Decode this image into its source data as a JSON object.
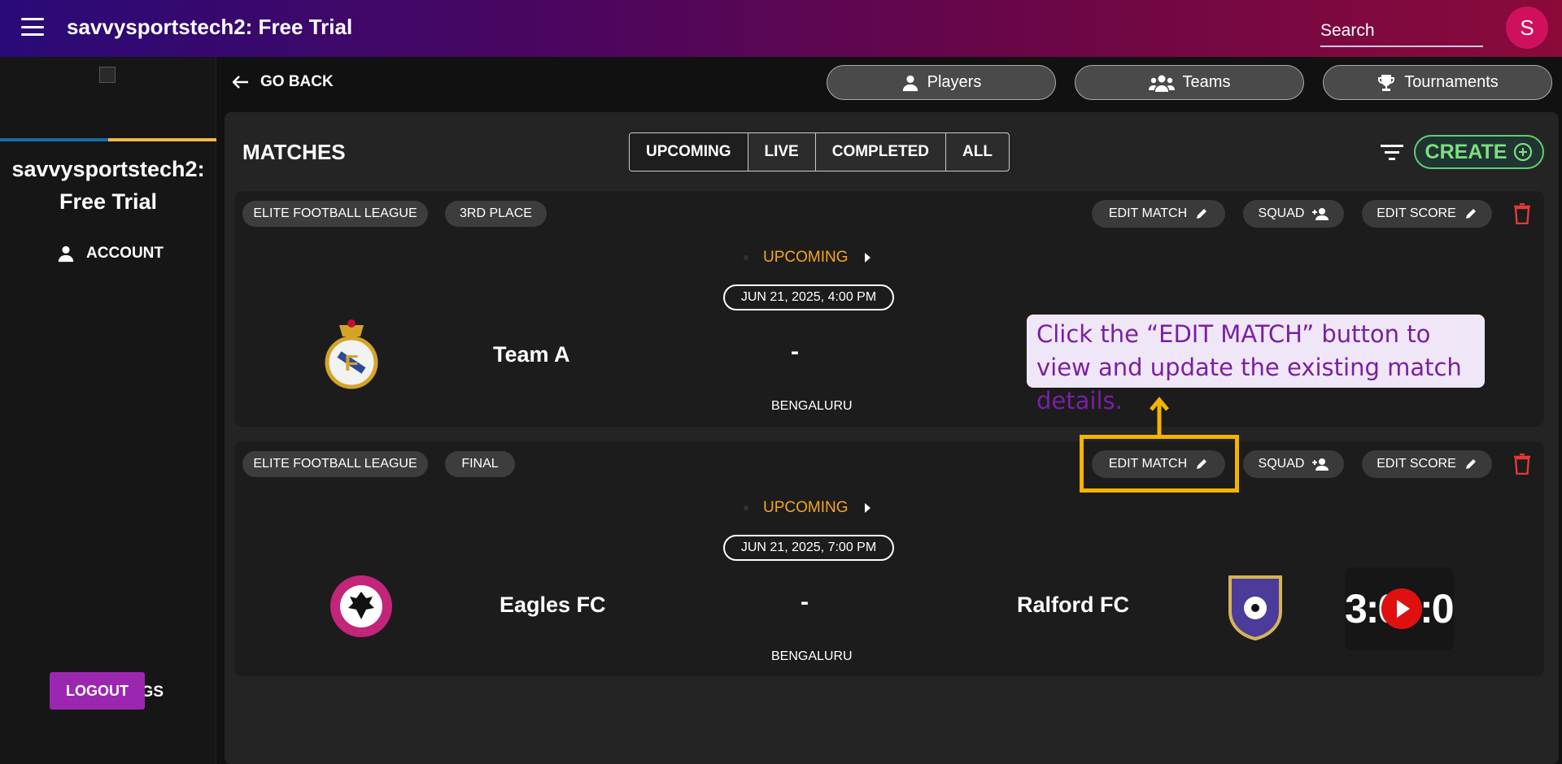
{
  "header": {
    "title": "savvysportstech2: Free Trial",
    "search_placeholder": "Search",
    "avatar_initial": "S",
    "gradient": [
      "#2a0a78",
      "#8a0a3a"
    ]
  },
  "sidebar": {
    "title": "savvysportstech2: Free Trial",
    "account_label": "ACCOUNT",
    "settings_label": "SETTINGS",
    "logout_label": "LOGOUT"
  },
  "nav": {
    "go_back": "GO BACK",
    "players": "Players",
    "teams": "Teams",
    "tournaments": "Tournaments"
  },
  "matches": {
    "title": "MATCHES",
    "tabs": [
      "UPCOMING",
      "LIVE",
      "COMPLETED",
      "ALL"
    ],
    "active_tab": "UPCOMING",
    "create_label": "CREATE",
    "accent": "#7be07f"
  },
  "cards": [
    {
      "league": "ELITE FOOTBALL LEAGUE",
      "round": "3RD PLACE",
      "edit_match": "EDIT MATCH",
      "squad": "SQUAD",
      "edit_score": "EDIT SCORE",
      "status": "UPCOMING",
      "datetime": "JUN 21, 2025, 4:00 PM",
      "home_team": "Team A",
      "score": "-",
      "venue": "BENGALURU"
    },
    {
      "league": "ELITE FOOTBALL LEAGUE",
      "round": "FINAL",
      "edit_match": "EDIT MATCH",
      "squad": "SQUAD",
      "edit_score": "EDIT SCORE",
      "status": "UPCOMING",
      "datetime": "JUN 21, 2025, 7:00 PM",
      "home_team": "Eagles FC",
      "away_team": "Ralford FC",
      "score": "-",
      "venue": "BENGALURU",
      "timer": "3:00:00"
    }
  ],
  "tooltip": {
    "text": "Click the “EDIT MATCH” button to view and update the existing match details.",
    "highlight_color": "#f5b400"
  }
}
